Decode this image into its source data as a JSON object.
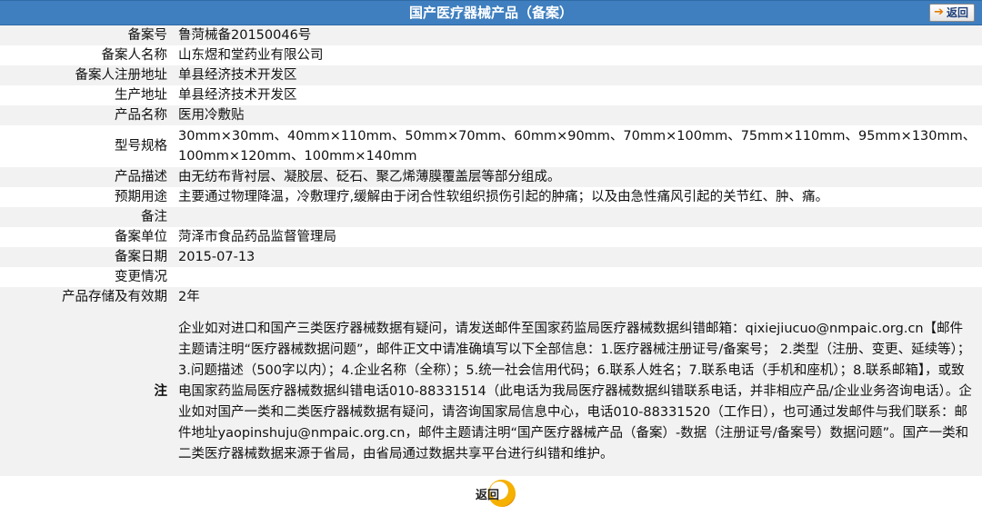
{
  "header": {
    "title": "国产医疗器械产品（备案）",
    "back_label": "返回"
  },
  "rows": [
    {
      "label": "备案号",
      "value": "鲁菏械备20150046号"
    },
    {
      "label": "备案人名称",
      "value": "山东煜和堂药业有限公司"
    },
    {
      "label": "备案人注册地址",
      "value": "单县经济技术开发区"
    },
    {
      "label": "生产地址",
      "value": "单县经济技术开发区"
    },
    {
      "label": "产品名称",
      "value": "医用冷敷贴"
    },
    {
      "label": "型号规格",
      "value": "30mm×30mm、40mm×110mm、50mm×70mm、60mm×90mm、70mm×100mm、75mm×110mm、95mm×130mm、100mm×120mm、100mm×140mm"
    },
    {
      "label": "产品描述",
      "value": "由无纺布背衬层、凝胶层、砭石、聚乙烯薄膜覆盖层等部分组成。"
    },
    {
      "label": "预期用途",
      "value": "主要通过物理降温，冷敷理疗,缓解由于闭合性软组织损伤引起的肿痛；以及由急性痛风引起的关节红、肿、痛。"
    },
    {
      "label": "备注",
      "value": ""
    },
    {
      "label": "备案单位",
      "value": "菏泽市食品药品监督管理局"
    },
    {
      "label": "备案日期",
      "value": "2015-07-13"
    },
    {
      "label": "变更情况",
      "value": ""
    },
    {
      "label": "产品存储及有效期",
      "value": "2年"
    },
    {
      "label": "注",
      "value": "企业如对进口和国产三类医疗器械数据有疑问，请发送邮件至国家药监局医疗器械数据纠错邮箱：qixiejiucuo@nmpaic.org.cn【邮件主题请注明“医疗器械数据问题”，邮件正文中请准确填写以下全部信息：1.医疗器械注册证号/备案号； 2.类型（注册、变更、延续等）；3.问题描述（500字以内）；4.企业名称（全称）；5.统一社会信用代码；6.联系人姓名；7.联系电话（手机和座机）；8.联系邮箱】，或致电国家药监局医疗器械数据纠错电话010-88331514（此电话为我局医疗器械数据纠错联系电话，并非相应产品/企业业务咨询电话）。企业如对国产一类和二类医疗器械数据有疑问，请咨询国家局信息中心，电话010-88331520（工作日），也可通过发邮件与我们联系：邮件地址yaopinshuju@nmpaic.org.cn，邮件主题请注明“国产医疗器械产品（备案）-数据（注册证号/备案号）数据问题”。国产一类和二类医疗器械数据来源于省局，由省局通过数据共享平台进行纠错和维护。"
    }
  ],
  "footer": {
    "back_label": "返回"
  },
  "colors": {
    "header_bg": "#3f7fbf",
    "row_alt_bg": "#f2f2f2",
    "back_accent": "#f5b000"
  }
}
